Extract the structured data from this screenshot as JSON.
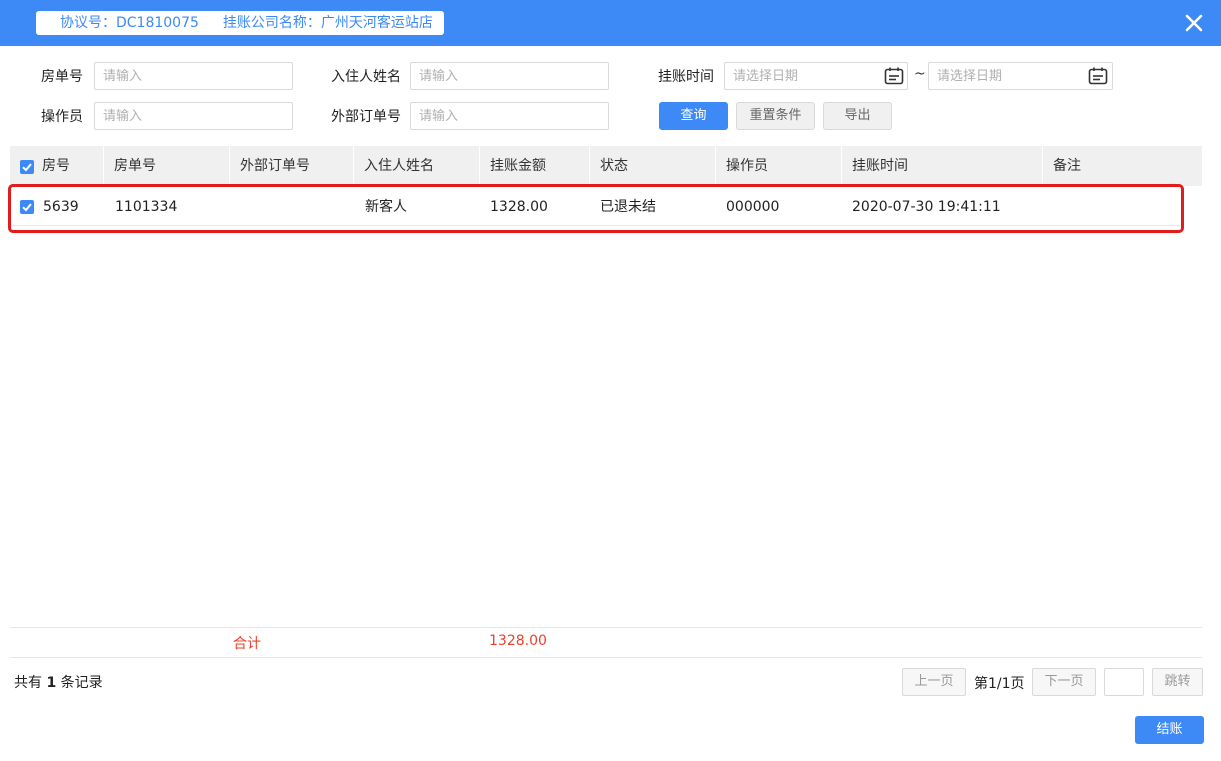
{
  "header": {
    "agreement_no": "协议号：DC1810075",
    "company_name": "挂账公司名称：广州天河客运站店",
    "close_icon": "close-icon"
  },
  "filters": {
    "room_no_label": "房单号",
    "room_no_placeholder": "请输入",
    "guest_name_label": "入住人姓名",
    "guest_name_placeholder": "请输入",
    "charge_time_label": "挂账时间",
    "date_start_placeholder": "请选择日期",
    "date_end_placeholder": "请选择日期",
    "date_separator": "~",
    "operator_label": "操作员",
    "operator_placeholder": "请输入",
    "external_order_label": "外部订单号",
    "external_order_placeholder": "请输入",
    "calendar_icon": "calendar-icon"
  },
  "buttons": {
    "query": "查询",
    "reset": "重置条件",
    "export": "导出",
    "settle": "结账"
  },
  "table": {
    "columns": [
      "房号",
      "房单号",
      "外部订单号",
      "入住人姓名",
      "挂账金额",
      "状态",
      "操作员",
      "挂账时间",
      "备注"
    ],
    "rows": [
      {
        "room": "5639",
        "order_no": "1101334",
        "external_order": "",
        "guest": "新客人",
        "amount": "1328.00",
        "status": "已退未结",
        "operator": "000000",
        "time": "2020-07-30 19:41:11",
        "remark": ""
      }
    ],
    "summary_label": "合计",
    "summary_amount": "1328.00"
  },
  "footer": {
    "total_prefix": "共有",
    "total_count": "1",
    "total_suffix": "条记录",
    "prev_page": "上一页",
    "page_info": "第1/1页",
    "next_page": "下一页",
    "jump": "跳转"
  },
  "colors": {
    "accent": "#3d8af7",
    "highlight_border": "#e21b1b",
    "summary_text": "#ef3f2b"
  }
}
